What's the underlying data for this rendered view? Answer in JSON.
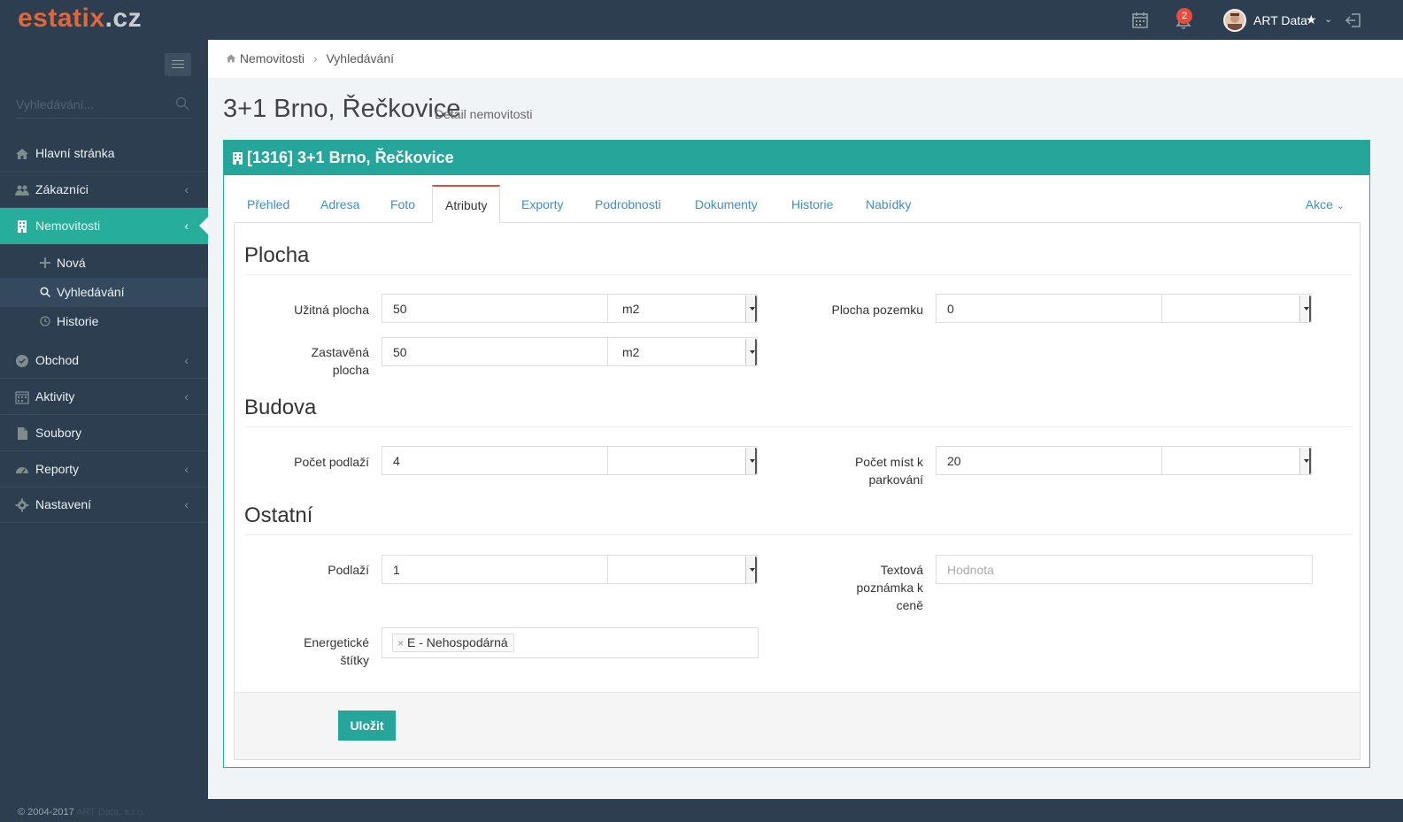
{
  "app": {
    "logo_part1": "estatix",
    "logo_part2": ".cz",
    "notification_count": "2",
    "user_name": "ART Data"
  },
  "sidebar": {
    "search_placeholder": "Vyhledávání...",
    "items": [
      {
        "label": "Hlavní stránka",
        "icon": "home-icon"
      },
      {
        "label": "Zákazníci",
        "icon": "users-icon"
      },
      {
        "label": "Nemovitosti",
        "icon": "building-icon"
      },
      {
        "label": "Obchod",
        "icon": "shopping-icon"
      },
      {
        "label": "Aktivity",
        "icon": "calendar-icon"
      },
      {
        "label": "Soubory",
        "icon": "file-icon"
      },
      {
        "label": "Reporty",
        "icon": "dashboard-icon"
      },
      {
        "label": "Nastavení",
        "icon": "gear-icon"
      }
    ],
    "subitems": [
      {
        "label": "Nová",
        "icon": "plus-icon"
      },
      {
        "label": "Vyhledávání",
        "icon": "search-icon"
      },
      {
        "label": "Historie",
        "icon": "clock-icon"
      }
    ],
    "copyright": "© 2004-2017",
    "copyright_brand": "ART Data, s.r.o."
  },
  "breadcrumb": [
    "Nemovitosti",
    "Vyhledávání"
  ],
  "page": {
    "title": "3+1 Brno, Řečkovice",
    "subtitle": "Detail nemovitosti"
  },
  "panel": {
    "title": "[1316] 3+1 Brno, Řečkovice"
  },
  "tabs": [
    "Přehled",
    "Adresa",
    "Foto",
    "Atributy",
    "Exporty",
    "Podrobnosti",
    "Dokumenty",
    "Historie",
    "Nabídky"
  ],
  "tabs_active": "Atributy",
  "tabs_more": "Akce",
  "form": {
    "section_plocha": "Plocha",
    "section_budova": "Budova",
    "section_ostatni": "Ostatní",
    "uzitna_label": "Užitná plocha",
    "uzitna_value": "50",
    "uzitna_unit": "m2",
    "zastavena_label_1": "Zastavěná",
    "zastavena_label_2": "plocha",
    "zastavena_value": "50",
    "zastavena_unit": "m2",
    "pozemek_label": "Plocha pozemku",
    "pozemek_value": "0",
    "pozemek_unit": "",
    "podlazi_count_label": "Počet podlaží",
    "podlazi_count_value": "4",
    "podlazi_count_unit": "",
    "parking_label_1": "Počet míst k",
    "parking_label_2": "parkování",
    "parking_value": "20",
    "parking_unit": "",
    "podlazi_label": "Podlaží",
    "podlazi_value": "1",
    "podlazi_unit": "",
    "poznamka_label_1": "Textová",
    "poznamka_label_2": "poznámka k",
    "poznamka_label_3": "ceně",
    "poznamka_placeholder": "Hodnota",
    "stitky_label_1": "Energetické",
    "stitky_label_2": "štítky",
    "stitky_tag": "E - Nehospodárná",
    "save_label": "Uložit"
  },
  "colors": {
    "accent": "#26a69a",
    "sidebar_bg": "#2c3e50",
    "tab_active_top": "#e74c3c",
    "link": "#3b8ed4",
    "logo_orange": "#e0673a"
  }
}
